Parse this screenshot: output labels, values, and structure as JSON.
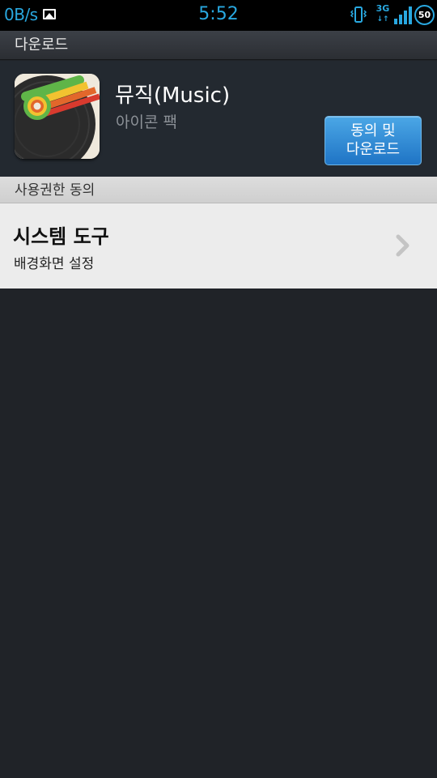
{
  "status_bar": {
    "speed": "0B/s",
    "time": "5:52",
    "network": "3G",
    "battery": "50",
    "icons": [
      "photo-icon",
      "vibrate-icon",
      "signal-icon",
      "battery-icon"
    ],
    "color": "#29a8e0"
  },
  "title_bar": {
    "title": "다운로드"
  },
  "app": {
    "name": "뮤직(Music)",
    "subtitle": "아이콘 팩",
    "button_line1": "동의 및",
    "button_line2": "다운로드"
  },
  "permissions": {
    "section_title": "사용권한 동의",
    "items": [
      {
        "title": "시스템 도구",
        "description": "배경화면 설정"
      }
    ]
  },
  "colors": {
    "accent": "#2b85d3",
    "background": "#202328"
  }
}
